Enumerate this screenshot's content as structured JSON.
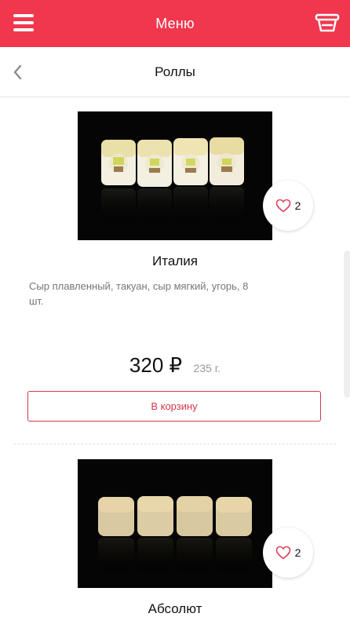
{
  "header": {
    "title": "Меню"
  },
  "subheader": {
    "title": "Роллы"
  },
  "products": [
    {
      "name": "Италия",
      "description": "Сыр плавленный, такуан, сыр мягкий, угорь, 8 шт.",
      "price": "320 ₽",
      "weight": "235 г.",
      "likes": "2",
      "add_label": "В корзину"
    },
    {
      "name": "Абсолют",
      "likes": "2"
    }
  ],
  "colors": {
    "accent": "#f0374e",
    "button_border": "#d1384d"
  },
  "icons": {
    "menu": "hamburger-icon",
    "cart": "basket-icon",
    "back": "chevron-left-icon",
    "like": "heart-icon"
  }
}
